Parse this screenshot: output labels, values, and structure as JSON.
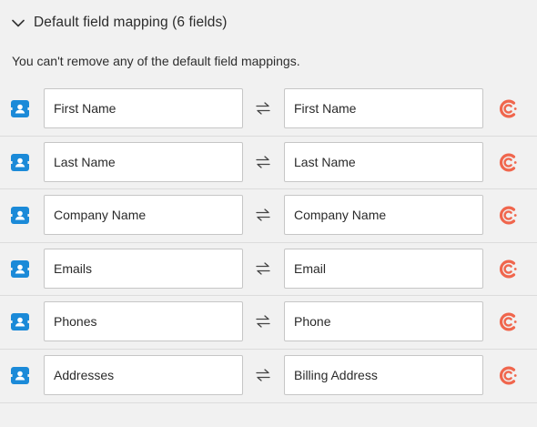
{
  "section": {
    "title": "Default field mapping (6 fields)",
    "notice": "You can't remove any of the default field mappings."
  },
  "icons": {
    "toggle": "chevron-down-icon",
    "source": "contact-card-icon",
    "swap": "swap-arrows-icon",
    "app": "app-c-logo-icon"
  },
  "colors": {
    "source_icon": "#1b8ad8",
    "app_icon": "#f0664d"
  },
  "mappings": [
    {
      "source": "First Name",
      "target": "First Name"
    },
    {
      "source": "Last Name",
      "target": "Last Name"
    },
    {
      "source": "Company Name",
      "target": "Company Name"
    },
    {
      "source": "Emails",
      "target": "Email"
    },
    {
      "source": "Phones",
      "target": "Phone"
    },
    {
      "source": "Addresses",
      "target": "Billing Address"
    }
  ]
}
